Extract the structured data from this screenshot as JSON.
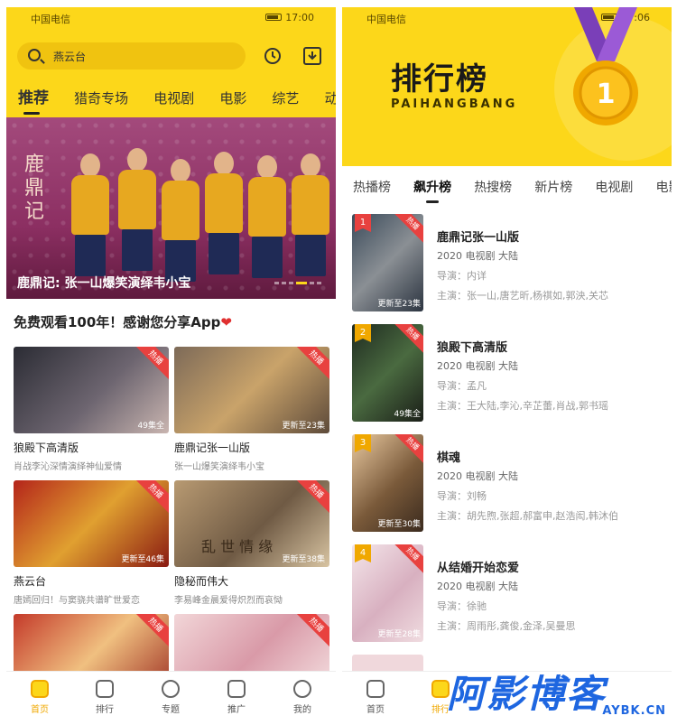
{
  "status": {
    "carrier": "中国电信",
    "time_left": "17:00",
    "time_right": "17:06"
  },
  "left": {
    "search": {
      "value": "燕云台"
    },
    "tabs": [
      "推荐",
      "猎奇专场",
      "电视剧",
      "电影",
      "综艺",
      "动"
    ],
    "banner": {
      "calligraphy": "鹿鼎记",
      "caption": "鹿鼎记: 张一山爆笑演绎韦小宝"
    },
    "promo": {
      "text": "免费观看100年！感谢您分享App",
      "heart": "❤"
    },
    "cards": [
      {
        "title": "狼殿下高清版",
        "desc": "肖战李沁深情演绎神仙爱情",
        "badge": "热播",
        "ep": "49集全"
      },
      {
        "title": "鹿鼎记张一山版",
        "desc": "张一山爆笑演绎韦小宝",
        "badge": "热播",
        "ep": "更新至23集"
      },
      {
        "title": "燕云台",
        "desc": "唐嫣回归！与窦骁共谱旷世爱恋",
        "badge": "热播",
        "ep": "更新至46集"
      },
      {
        "title": "隐秘而伟大",
        "desc": "李易峰金晨爱得炽烈而哀恸",
        "badge": "热播",
        "ep": "更新至38集",
        "art": "乱 世 情 缘"
      },
      {
        "title": "",
        "desc": "",
        "badge": "热播",
        "ep": ""
      },
      {
        "title": "",
        "desc": "",
        "badge": "热播",
        "ep": ""
      }
    ],
    "nav": [
      {
        "label": "首页",
        "icon": "home-icon",
        "active": true
      },
      {
        "label": "排行",
        "icon": "crown-icon",
        "active": false
      },
      {
        "label": "专题",
        "icon": "film-reel-icon",
        "active": false
      },
      {
        "label": "推广",
        "icon": "share-icon",
        "active": false
      },
      {
        "label": "我的",
        "icon": "profile-icon",
        "active": false
      }
    ]
  },
  "right": {
    "title": "排行榜",
    "subtitle": "PAIHANGBANG",
    "medal_number": "1",
    "tabs": [
      "热播榜",
      "飙升榜",
      "热搜榜",
      "新片榜",
      "电视剧",
      "电影"
    ],
    "items": [
      {
        "rank": "1",
        "name": "鹿鼎记张一山版",
        "meta": "2020  电视剧  大陆",
        "director": "导演：内详",
        "cast": "主演：张一山,唐艺昕,杨祺如,郭泱,关芯",
        "badge": "热播",
        "ep": "更新至23集"
      },
      {
        "rank": "2",
        "name": "狼殿下高清版",
        "meta": "2020  电视剧  大陆",
        "director": "导演：孟凡",
        "cast": "主演：王大陆,李沁,辛芷蕾,肖战,郭书瑶",
        "badge": "热播",
        "ep": "49集全"
      },
      {
        "rank": "3",
        "name": "棋魂",
        "meta": "2020  电视剧  大陆",
        "director": "导演：刘畅",
        "cast": "主演：胡先煦,张超,郝富申,赵浩闳,韩沐伯",
        "badge": "热播",
        "ep": "更新至30集"
      },
      {
        "rank": "4",
        "name": "从结婚开始恋爱",
        "meta": "2020  电视剧  大陆",
        "director": "导演：徐驰",
        "cast": "主演：周雨彤,龚俊,金泽,吴曼思",
        "badge": "热播",
        "ep": "更新至28集"
      }
    ],
    "nav": [
      {
        "label": "首页",
        "icon": "home-icon",
        "active": false
      },
      {
        "label": "排行",
        "icon": "crown-icon",
        "active": true
      }
    ]
  },
  "watermark": {
    "big": "阿影博客",
    "small": "AYBK.CN"
  },
  "colors": {
    "accent": "#fcd71a",
    "badge": "#e8413f",
    "watermark": "#1e66e0"
  }
}
